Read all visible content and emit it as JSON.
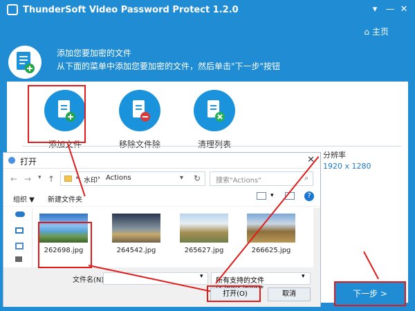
{
  "app": {
    "title": "ThunderSoft Video Password Protect 1.2.0",
    "home_label": "主页",
    "header_line1": "添加您要加密的文件",
    "header_line2": "从下面的菜单中添加您要加密的文件，然后单击\"下一步\"按钮"
  },
  "toolbar": {
    "add_file": "添加文件",
    "remove_file": "移除文件除",
    "clear_list": "清理列表"
  },
  "table": {
    "resolution_header": "分辨率",
    "resolution_value": "1920 x 1280"
  },
  "next_button": "下一步 >",
  "dialog": {
    "title": "打开",
    "path_prefix": "«",
    "folder1": "水印",
    "folder2": "Actions",
    "search_placeholder": "搜索\"Actions\"",
    "organize": "组织 ▼",
    "new_folder": "新建文件夹",
    "filename_label": "文件名(N):",
    "file_filter": "所有支持的文件 (*.jpg;*.jpeg;*",
    "open_button": "打开(O)",
    "cancel_button": "取消",
    "files": [
      {
        "name": "262698.jpg"
      },
      {
        "name": "264542.jpg"
      },
      {
        "name": "265627.jpg"
      },
      {
        "name": "266625.jpg"
      }
    ]
  }
}
